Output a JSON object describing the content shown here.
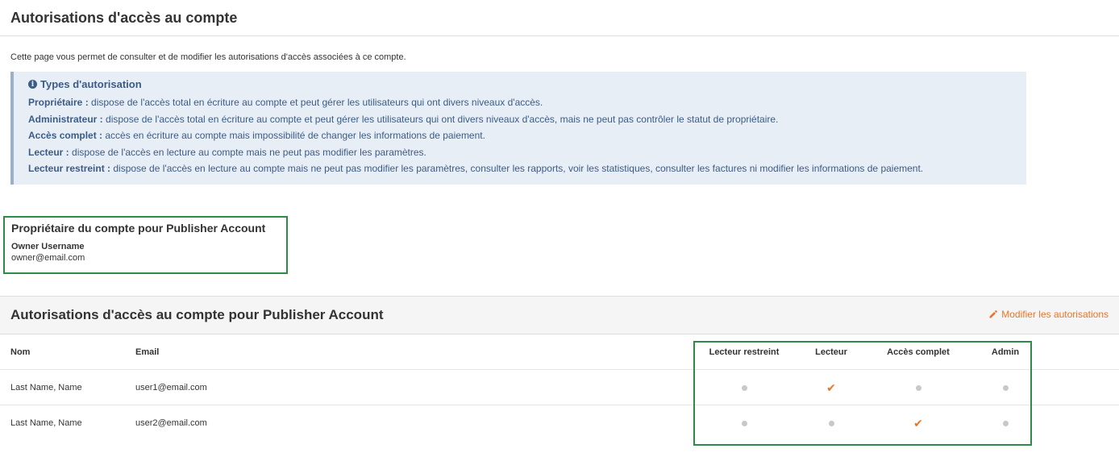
{
  "page": {
    "title": "Autorisations d'accès au compte"
  },
  "intro": "Cette page vous permet de consulter et de modifier les autorisations d'accès associées à ce compte.",
  "info": {
    "title": "Types d'autorisation",
    "items": [
      {
        "term": "Propriétaire :",
        "desc": " dispose de l'accès total en écriture au compte et peut gérer les utilisateurs qui ont divers niveaux d'accès."
      },
      {
        "term": "Administrateur :",
        "desc": " dispose de l'accès total en écriture au compte et peut gérer les utilisateurs qui ont divers niveaux d'accès, mais ne peut pas contrôler le statut de propriétaire."
      },
      {
        "term": "Accès complet :",
        "desc": " accès en écriture au compte mais impossibilité de changer les informations de paiement."
      },
      {
        "term": "Lecteur :",
        "desc": " dispose de l'accès en lecture au compte mais ne peut pas modifier les paramètres."
      },
      {
        "term": "Lecteur restreint :",
        "desc": " dispose de l'accès en lecture au compte mais ne peut pas modifier les paramètres, consulter les rapports, voir les statistiques, consulter les factures ni modifier les informations de paiement."
      }
    ]
  },
  "owner": {
    "title": "Propriétaire du compte pour Publisher Account",
    "label": "Owner Username",
    "value": "owner@email.com"
  },
  "permissions": {
    "title": "Autorisations d'accès au compte pour Publisher Account",
    "edit_label": "Modifier les autorisations",
    "columns": {
      "name": "Nom",
      "email": "Email",
      "restricted_reader": "Lecteur restreint",
      "reader": "Lecteur",
      "full_access": "Accès complet",
      "admin": "Admin"
    },
    "rows": [
      {
        "name": "Last Name, Name",
        "email": "user1@email.com",
        "access": [
          "none",
          "checked",
          "none",
          "none"
        ]
      },
      {
        "name": "Last Name, Name",
        "email": "user2@email.com",
        "access": [
          "none",
          "none",
          "checked",
          "none"
        ]
      }
    ]
  },
  "colors": {
    "accent": "#e8752b",
    "info_text": "#3b5c86",
    "highlight": "#2e8b46"
  }
}
